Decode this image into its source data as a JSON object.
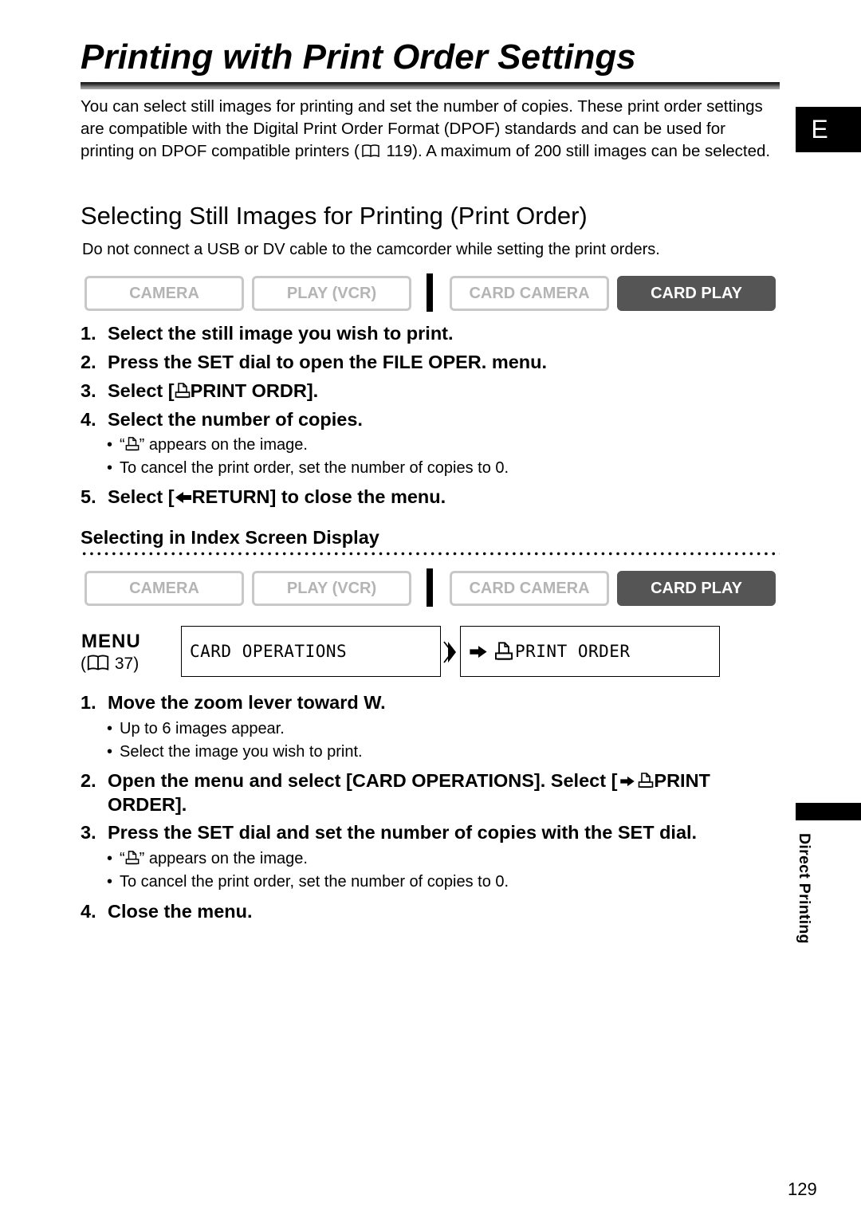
{
  "page": {
    "title": "Printing with Print Order Settings",
    "intro_part1": "You can select still images for printing and set the number of copies. These print order settings are compatible with the Digital Print Order Format (DPOF) standards and can be used for printing on DPOF compatible printers (",
    "intro_ref": "119",
    "intro_part2": "). A maximum of 200 still images can be selected.",
    "language_tab": "E",
    "side_section": "Direct Printing",
    "page_number": "129"
  },
  "section": {
    "title": "Selecting Still Images for Printing (Print Order)",
    "note": "Do not connect a USB or DV cable to the camcorder while setting the print orders."
  },
  "modes": [
    {
      "label": "CAMERA",
      "active": false
    },
    {
      "label": "PLAY (VCR)",
      "active": false
    },
    {
      "label": "CARD CAMERA",
      "active": false
    },
    {
      "label": "CARD PLAY",
      "active": true
    }
  ],
  "steps_a": [
    {
      "num": "1.",
      "text": "Select the still image you wish to print."
    },
    {
      "num": "2.",
      "text": "Press the SET dial to open the FILE OPER. menu."
    },
    {
      "num": "3.",
      "pre": "Select [",
      "icon": "print-icon",
      "text": "PRINT ORDR]."
    },
    {
      "num": "4.",
      "text": "Select the number of copies."
    },
    {
      "num": "5.",
      "pre": "Select [",
      "icon": "return-arrow-icon",
      "text": "RETURN] to close the menu."
    }
  ],
  "bullets_a": [
    {
      "pre": "“",
      "icon": "print-icon",
      "text": "” appears on the image."
    },
    {
      "text": "To cancel the print order, set the number of copies to 0."
    }
  ],
  "index_section": {
    "title": "Selecting in Index Screen Display",
    "menu_label": "MENU",
    "menu_ref": "37",
    "menu_path": [
      "CARD OPERATIONS",
      "PRINT ORDER"
    ]
  },
  "steps_b": [
    {
      "num": "1.",
      "text": "Move the zoom lever toward ",
      "bold_tail": "W."
    },
    {
      "num": "2.",
      "text_line1_pre": "Open the menu and select [CARD OPERATIONS]. Select [",
      "text_line1_post": "PRINT",
      "text_line2": "ORDER]."
    },
    {
      "num": "3.",
      "text": "Press the SET dial and set the number of copies with the SET dial."
    },
    {
      "num": "4.",
      "text": "Close the menu."
    }
  ],
  "bullets_b1": [
    {
      "text": "Up to 6 images appear."
    },
    {
      "text": "Select the image you wish to print."
    }
  ],
  "bullets_b3": [
    {
      "pre": "“",
      "text": "” appears on the image."
    },
    {
      "text": "To cancel the print order, set the number of copies to 0."
    }
  ],
  "bullet_char": "•"
}
